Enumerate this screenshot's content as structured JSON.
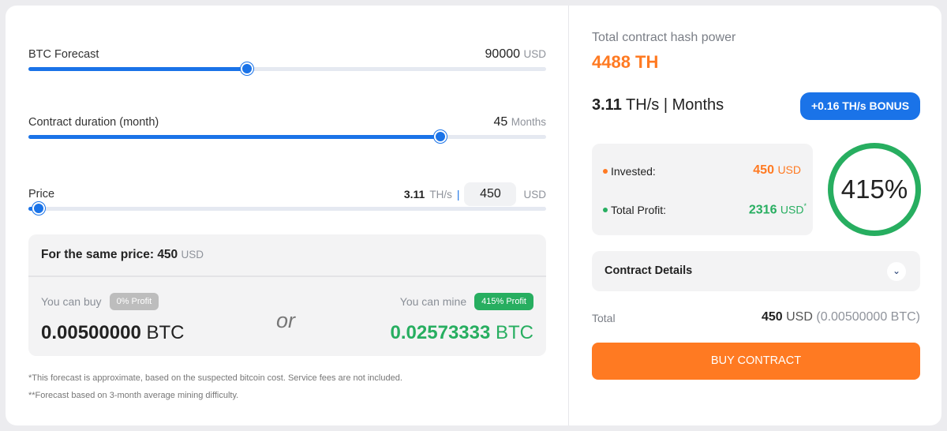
{
  "forecast": {
    "label": "BTC Forecast",
    "value": "90000",
    "unit": "USD",
    "level_percent": 42.2
  },
  "duration": {
    "label": "Contract duration (month)",
    "value": "45",
    "unit": "Months",
    "level_percent": 79.6
  },
  "price": {
    "label": "Price",
    "rate": "3.11",
    "rate_unit": "TH/s",
    "separator": "|",
    "input_value": "450",
    "unit": "USD",
    "level_percent": 2.0
  },
  "comparison": {
    "header_prefix": "For the same price:",
    "header_value": "450",
    "header_unit": "USD",
    "buy_label": "You can buy",
    "buy_badge": "0% Profit",
    "buy_value": "0.00500000",
    "buy_unit": "BTC",
    "or_text": "or",
    "mine_label": "You can mine",
    "mine_badge": "415% Profit",
    "mine_value": "0.02573333",
    "mine_unit": "BTC"
  },
  "notes": [
    "*This forecast is approximate, based on the suspected bitcoin cost. Service fees are not included.",
    "**Forecast based on 3-month average mining difficulty."
  ],
  "summary": {
    "hash_label": "Total contract hash power",
    "hash_value": "4488 TH",
    "rate": "3.11",
    "rate_unit": "TH/s",
    "rate_sep": "|",
    "months_label": "Months",
    "bonus_label": "+0.16 TH/s BONUS",
    "invested_label": "Invested:",
    "invested_value": "450",
    "invested_unit": "USD",
    "profit_label": "Total Profit:",
    "profit_value": "2316",
    "profit_unit": "USD",
    "profit_mark": "*",
    "roi": "415%",
    "details_label": "Contract Details",
    "total_label": "Total",
    "total_value": "450",
    "total_unit": "USD",
    "total_btc": "(0.00500000 BTC)",
    "buy_label": "BUY CONTRACT"
  },
  "colors": {
    "accent": "#1a73e8",
    "orange": "#ff7a22",
    "green": "#27ae60",
    "grey_badge": "#bdbdbd"
  }
}
